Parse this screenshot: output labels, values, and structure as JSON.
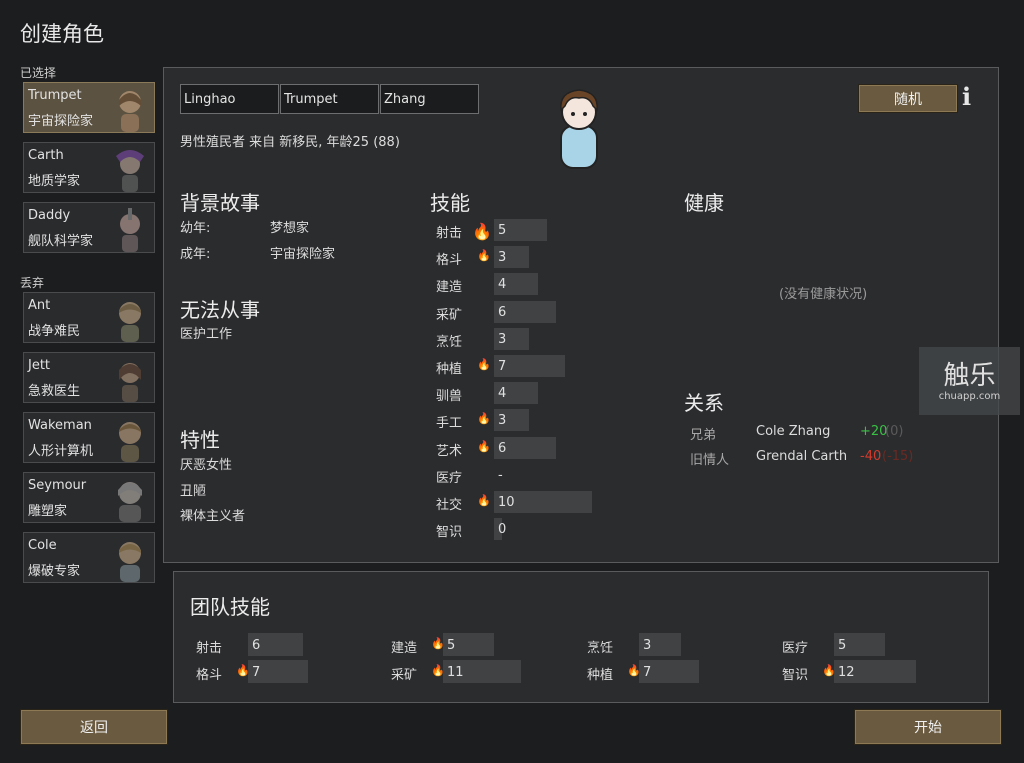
{
  "title": "创建角色",
  "selected_label": "已选择",
  "discarded_label": "丢弃",
  "selected_pawns": [
    {
      "name": "Trumpet",
      "title": "宇宙探险家"
    },
    {
      "name": "Carth",
      "title": "地质学家"
    },
    {
      "name": "Daddy",
      "title": "舰队科学家"
    }
  ],
  "discarded_pawns": [
    {
      "name": "Ant",
      "title": "战争难民"
    },
    {
      "name": "Jett",
      "title": "急救医生"
    },
    {
      "name": "Wakeman",
      "title": "人形计算机"
    },
    {
      "name": "Seymour",
      "title": "雕塑家"
    },
    {
      "name": "Cole",
      "title": "爆破专家"
    }
  ],
  "name_first": "Linghao",
  "name_nick": "Trumpet",
  "name_last": "Zhang",
  "random_button": "随机",
  "info_icon_glyph": "i",
  "description": "男性殖民者 来自 新移民, 年龄25 (88)",
  "backstory": {
    "heading": "背景故事",
    "childhood_label": "幼年:",
    "childhood_value": "梦想家",
    "adulthood_label": "成年:",
    "adulthood_value": "宇宙探险家"
  },
  "incapable": {
    "heading": "无法从事",
    "items": [
      "医护工作"
    ]
  },
  "traits": {
    "heading": "特性",
    "items": [
      "厌恶女性",
      "丑陋",
      "裸体主义者"
    ]
  },
  "skills_heading": "技能",
  "skills": [
    {
      "name": "射击",
      "level": "5",
      "passion": 2
    },
    {
      "name": "格斗",
      "level": "3",
      "passion": 1
    },
    {
      "name": "建造",
      "level": "4",
      "passion": 0
    },
    {
      "name": "采矿",
      "level": "6",
      "passion": 0
    },
    {
      "name": "烹饪",
      "level": "3",
      "passion": 0
    },
    {
      "name": "种植",
      "level": "7",
      "passion": 1
    },
    {
      "name": "驯兽",
      "level": "4",
      "passion": 0
    },
    {
      "name": "手工",
      "level": "3",
      "passion": 1
    },
    {
      "name": "艺术",
      "level": "6",
      "passion": 1
    },
    {
      "name": "医疗",
      "level": "-",
      "passion": 0
    },
    {
      "name": "社交",
      "level": "10",
      "passion": 1
    },
    {
      "name": "智识",
      "level": "0",
      "passion": 0
    }
  ],
  "health": {
    "heading": "健康",
    "empty": "(没有健康状况)"
  },
  "relations": {
    "heading": "关系",
    "items": [
      {
        "type": "兄弟",
        "name": "Cole Zhang",
        "value": "+20",
        "extra": "(0)",
        "color": "#39c144"
      },
      {
        "type": "旧情人",
        "name": "Grendal Carth",
        "value": "-40",
        "extra": "(-15)",
        "color": "#d33b2d"
      }
    ]
  },
  "team": {
    "heading": "团队技能",
    "skills": [
      {
        "name": "射击",
        "value": "6",
        "passion": false
      },
      {
        "name": "格斗",
        "value": "7",
        "passion": true
      },
      {
        "name": "建造",
        "value": "5",
        "passion": true
      },
      {
        "name": "采矿",
        "value": "11",
        "passion": true
      },
      {
        "name": "烹饪",
        "value": "3",
        "passion": false
      },
      {
        "name": "种植",
        "value": "7",
        "passion": true
      },
      {
        "name": "医疗",
        "value": "5",
        "passion": false
      },
      {
        "name": "智识",
        "value": "12",
        "passion": true
      }
    ]
  },
  "back_button": "返回",
  "start_button": "开始",
  "watermark": {
    "logo": "触乐",
    "url": "chuapp.com"
  },
  "colors": {
    "accent_button": "#6a5a3f",
    "selected_card": "#5c5241",
    "passion": "#e39a2b"
  }
}
